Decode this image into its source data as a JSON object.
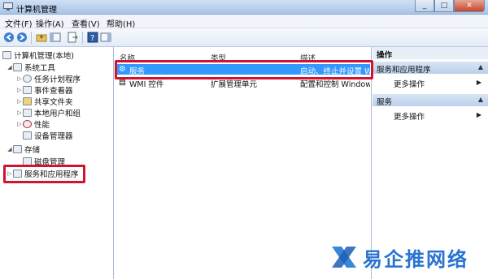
{
  "window": {
    "title": "计算机管理"
  },
  "menu": [
    "文件(F)",
    "操作(A)",
    "查看(V)",
    "帮助(H)"
  ],
  "tree": {
    "root": "计算机管理(本地)",
    "system_tools": "系统工具",
    "task_scheduler": "任务计划程序",
    "event_viewer": "事件查看器",
    "shared_folders": "共享文件夹",
    "local_users": "本地用户和组",
    "performance": "性能",
    "device_manager": "设备管理器",
    "storage": "存储",
    "disk_management": "磁盘管理",
    "services_apps": "服务和应用程序"
  },
  "list": {
    "headers": {
      "name": "名称",
      "type": "类型",
      "desc": "描述"
    },
    "rows": [
      {
        "name": "服务",
        "type": "",
        "desc": "启动、终止并设置 Wi"
      },
      {
        "name": "WMI 控件",
        "type": "扩展管理单元",
        "desc": "配置和控制 Windows"
      }
    ]
  },
  "actions": {
    "header": "操作",
    "section1": "服务和应用程序",
    "section1_more": "更多操作",
    "section2": "服务",
    "section2_more": "更多操作"
  },
  "watermark": {
    "text": "易企推网络"
  },
  "colors": {
    "highlight": "#d0142d",
    "selection": "#3399ff"
  }
}
